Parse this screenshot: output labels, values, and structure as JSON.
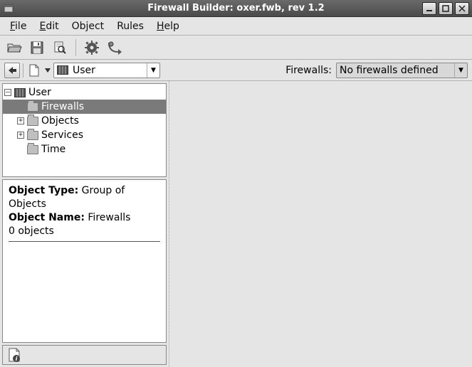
{
  "window": {
    "title": "Firewall Builder: oxer.fwb, rev 1.2"
  },
  "menubar": {
    "file": "File",
    "edit": "Edit",
    "object": "Object",
    "rules": "Rules",
    "help": "Help"
  },
  "toolbar": {
    "open_icon": "open-folder-icon",
    "save_icon": "save-icon",
    "find_icon": "find-icon",
    "compile_icon": "compile-icon",
    "install_icon": "install-icon"
  },
  "navbar": {
    "back_icon": "back-arrow-icon",
    "new_icon": "new-page-icon",
    "library_selected": "User",
    "firewalls_label": "Firewalls:",
    "firewalls_selected": "No firewalls defined"
  },
  "tree": {
    "root": {
      "label": "User",
      "expanded": true
    },
    "items": [
      {
        "label": "Firewalls",
        "selected": true,
        "expandable": false
      },
      {
        "label": "Objects",
        "selected": false,
        "expandable": true
      },
      {
        "label": "Services",
        "selected": false,
        "expandable": true
      },
      {
        "label": "Time",
        "selected": false,
        "expandable": false
      }
    ]
  },
  "properties": {
    "type_label": "Object Type:",
    "type_value": "Group of Objects",
    "name_label": "Object Name:",
    "name_value": "Firewalls",
    "count_text": "0 objects"
  }
}
